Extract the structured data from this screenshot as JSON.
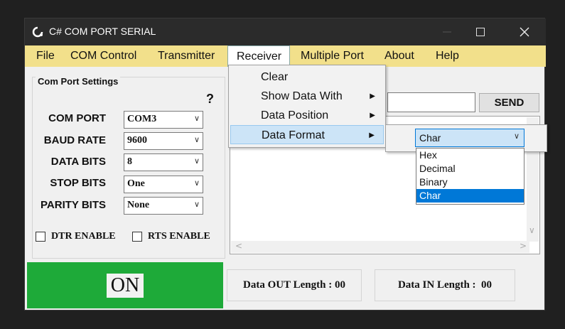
{
  "window": {
    "title": "C# COM PORT SERIAL"
  },
  "menu": [
    "File",
    "COM Control",
    "Transmitter",
    "Receiver",
    "Multiple Port",
    "About",
    "Help"
  ],
  "settings": {
    "group_title": "Com Port Settings",
    "help_mark": "?",
    "rows": [
      {
        "label": "COM PORT",
        "value": "COM3"
      },
      {
        "label": "BAUD RATE",
        "value": "9600"
      },
      {
        "label": "DATA BITS",
        "value": "8"
      },
      {
        "label": "STOP BITS",
        "value": "One"
      },
      {
        "label": "PARITY BITS",
        "value": "None"
      }
    ],
    "dtr_label": "DTR ENABLE",
    "rts_label": "RTS ENABLE"
  },
  "on_button": {
    "label": "ON",
    "color": "#1eaa39"
  },
  "transmit": {
    "send_label": "SEND",
    "input_value": ""
  },
  "status": {
    "out_label": "Data OUT Length :",
    "out_value": "00",
    "in_label": "Data IN Length :",
    "in_value": "00"
  },
  "receiver_menu": {
    "items": [
      "Clear",
      "Show Data With",
      "Data Position",
      "Data Format"
    ],
    "highlighted": "Data Format"
  },
  "data_format": {
    "selected": "Char",
    "options": [
      "Hex",
      "Decimal",
      "Binary",
      "Char"
    ]
  },
  "colors": {
    "menubar": "#f2e08b",
    "titlebar": "#2b2b2b",
    "accent": "#0078d7"
  }
}
